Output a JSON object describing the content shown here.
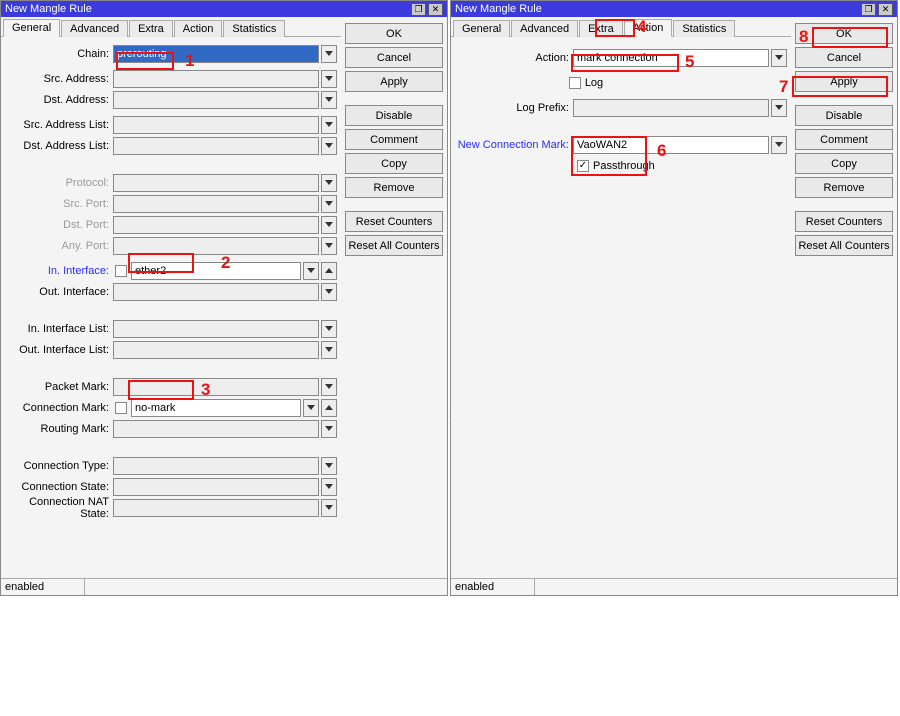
{
  "windows": [
    {
      "title": "New Mangle Rule",
      "tabs": [
        "General",
        "Advanced",
        "Extra",
        "Action",
        "Statistics"
      ],
      "activeTab": 0,
      "status": "enabled",
      "buttons": [
        "OK",
        "Cancel",
        "Apply",
        "Disable",
        "Comment",
        "Copy",
        "Remove",
        "Reset Counters",
        "Reset All Counters"
      ],
      "fields": {
        "chain": "prerouting",
        "src_address": "",
        "dst_address": "",
        "src_address_list": "",
        "dst_address_list": "",
        "protocol": "",
        "src_port": "",
        "dst_port": "",
        "any_port": "",
        "in_interface": "ether2",
        "out_interface": "",
        "in_interface_list": "",
        "out_interface_list": "",
        "packet_mark": "",
        "connection_mark": "no-mark",
        "routing_mark": "",
        "connection_type": "",
        "connection_state": "",
        "connection_nat_state": ""
      },
      "labels": {
        "chain": "Chain:",
        "src_address": "Src. Address:",
        "dst_address": "Dst. Address:",
        "src_address_list": "Src. Address List:",
        "dst_address_list": "Dst. Address List:",
        "protocol": "Protocol:",
        "src_port": "Src. Port:",
        "dst_port": "Dst. Port:",
        "any_port": "Any. Port:",
        "in_interface": "In. Interface:",
        "out_interface": "Out. Interface:",
        "in_interface_list": "In. Interface List:",
        "out_interface_list": "Out. Interface List:",
        "packet_mark": "Packet Mark:",
        "connection_mark": "Connection Mark:",
        "routing_mark": "Routing Mark:",
        "connection_type": "Connection Type:",
        "connection_state": "Connection State:",
        "connection_nat_state": "Connection NAT State:"
      },
      "annotations": {
        "1": "1",
        "2": "2",
        "3": "3"
      }
    },
    {
      "title": "New Mangle Rule",
      "tabs": [
        "General",
        "Advanced",
        "Extra",
        "Action",
        "Statistics"
      ],
      "activeTab": 3,
      "status": "enabled",
      "buttons": [
        "OK",
        "Cancel",
        "Apply",
        "Disable",
        "Comment",
        "Copy",
        "Remove",
        "Reset Counters",
        "Reset All Counters"
      ],
      "fields": {
        "action": "mark connection",
        "log": false,
        "log_prefix": "",
        "new_connection_mark": "VaoWAN2",
        "passthrough": true
      },
      "labels": {
        "action": "Action:",
        "log": "Log",
        "log_prefix": "Log Prefix:",
        "new_connection_mark": "New Connection Mark:",
        "passthrough": "Passthrough"
      },
      "annotations": {
        "4": "4",
        "5": "5",
        "6": "6",
        "7": "7",
        "8": "8"
      }
    }
  ]
}
